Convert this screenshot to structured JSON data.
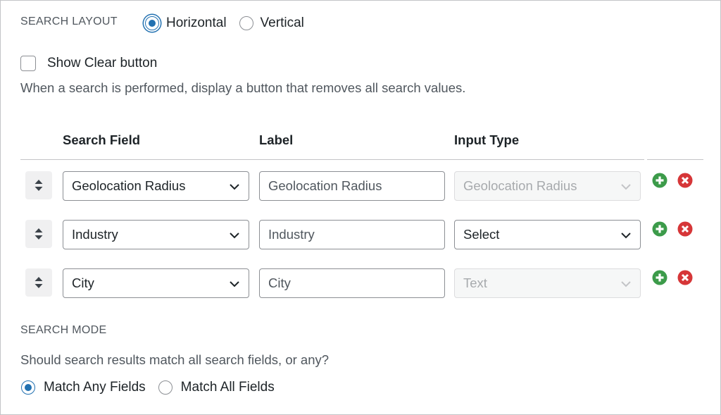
{
  "search_layout": {
    "label": "SEARCH LAYOUT",
    "options": [
      {
        "label": "Horizontal",
        "checked": true
      },
      {
        "label": "Vertical",
        "checked": false
      }
    ]
  },
  "clear_button": {
    "label": "Show Clear button",
    "checked": false,
    "description": "When a search is performed, display a button that removes all search values."
  },
  "table": {
    "headers": {
      "search_field": "Search Field",
      "label": "Label",
      "input_type": "Input Type"
    },
    "rows": [
      {
        "search_field": "Geolocation Radius",
        "label_placeholder": "Geolocation Radius",
        "input_type": "Geolocation Radius",
        "input_type_disabled": true
      },
      {
        "search_field": "Industry",
        "label_placeholder": "Industry",
        "input_type": "Select",
        "input_type_disabled": false
      },
      {
        "search_field": "City",
        "label_placeholder": "City",
        "input_type": "Text",
        "input_type_disabled": true
      }
    ]
  },
  "search_mode": {
    "label": "SEARCH MODE",
    "description": "Should search results match all search fields, or any?",
    "options": [
      {
        "label": "Match Any Fields",
        "checked": true
      },
      {
        "label": "Match All Fields",
        "checked": false
      }
    ]
  },
  "colors": {
    "accent": "#2271b1",
    "add": "#3c9b4a",
    "remove": "#d63638"
  },
  "icons": {
    "handle": "sort-handle-icon",
    "add": "plus-circle-icon",
    "remove": "x-circle-icon",
    "select": "chevron-down-icon"
  }
}
